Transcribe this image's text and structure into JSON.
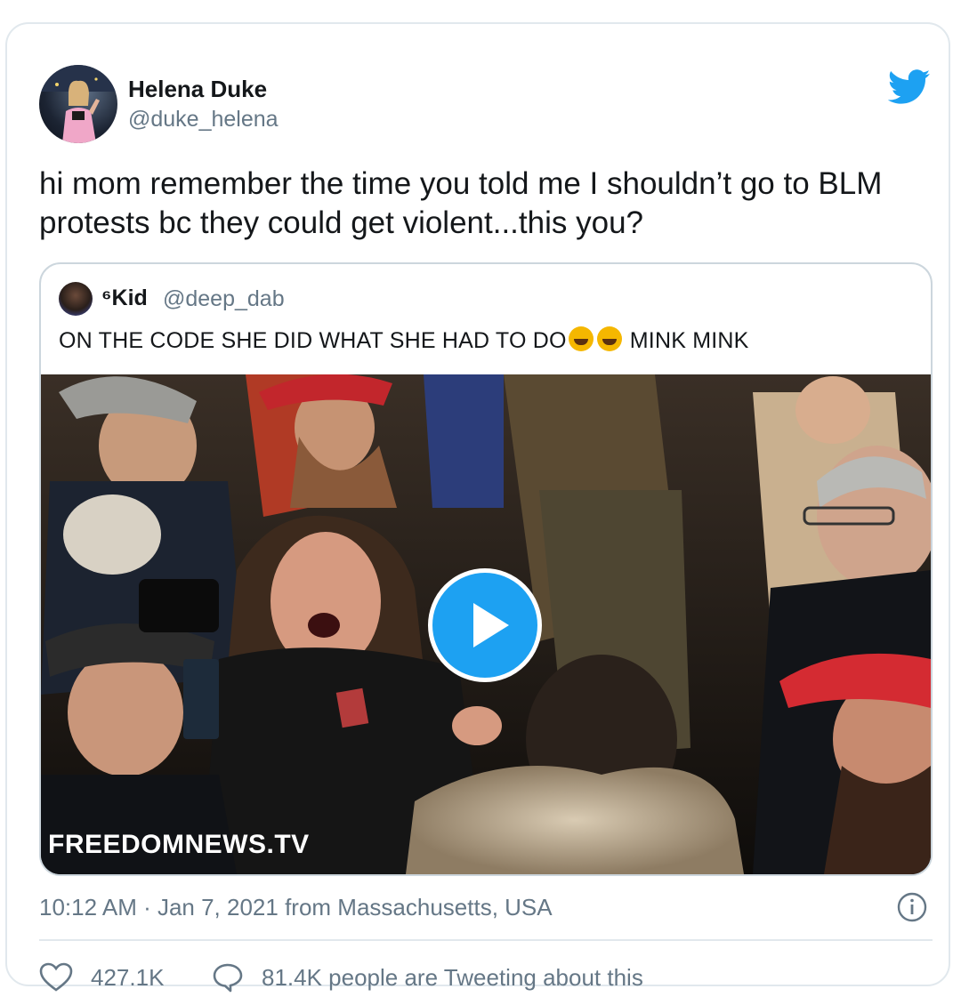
{
  "tweet": {
    "author_name": "Helena Duke",
    "author_handle": "@duke_helena",
    "text": "hi mom remember the time you told me I shouldn’t go to BLM protests bc they could get violent...this you?",
    "timestamp": "10:12 AM · Jan 7, 2021 from Massachusetts, USA",
    "likes": "427.1K",
    "engagement": "81.4K people are Tweeting about this"
  },
  "quoted": {
    "author_name": "⁶Kid",
    "author_handle": "@deep_dab",
    "text_before_emoji": "ON THE CODE SHE DID WHAT SHE HAD TO DO",
    "emoji": "🤣🤣",
    "text_after_emoji": " MINK MINK",
    "watermark": "FREEDOMNEWS.TV"
  },
  "icons": {
    "brand": "twitter-bird-icon",
    "info": "info-icon",
    "like": "heart-icon",
    "reply": "speech-bubble-icon",
    "play": "play-icon"
  },
  "colors": {
    "accent": "#1da1f2",
    "text_primary": "#14171a",
    "text_secondary": "#657786",
    "border": "#e1e8ed"
  }
}
